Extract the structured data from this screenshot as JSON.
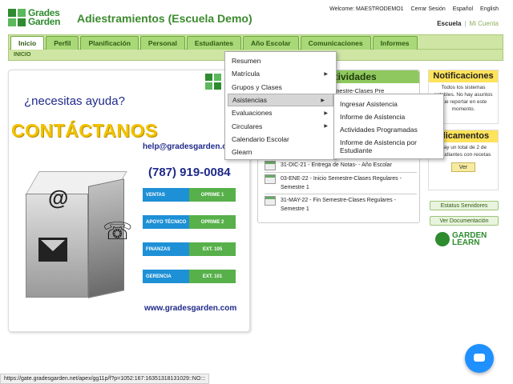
{
  "header": {
    "logo_line1": "Grades",
    "logo_line2": "Garden",
    "title": "Adiestramientos (Escuela Demo)",
    "welcome": "Welcome: MAESTRODEMO1",
    "logout": "Cerrar Sesión",
    "lang_es": "Español",
    "lang_en": "English",
    "school": "Escuela",
    "my_account": "Mi Cuenta"
  },
  "nav": {
    "tabs": [
      "Inicio",
      "Perfil",
      "Planificación",
      "Personal",
      "Estudiantes",
      "Año Escolar",
      "Comunicaciones",
      "Informes"
    ],
    "breadcrumb": "INICIO"
  },
  "contact": {
    "help": "¿necesitas ayuda?",
    "headline": "CONTÁCTANOS",
    "email": "help@gradesgarden.co",
    "phone": "(787) 919-0084",
    "rows": [
      {
        "label": "VENTAS",
        "value": "OPRIME 1"
      },
      {
        "label": "APOYO TÉCNICO",
        "value": "OPRIME 2"
      },
      {
        "label": "FINANZAS",
        "value": "EXT. 105"
      },
      {
        "label": "GERENCIA",
        "value": "EXT. 101"
      }
    ],
    "website": "www.gradesgarden.com"
  },
  "activities": {
    "header": "ctividades",
    "fragment": "Semestre-Clases Pre",
    "items": [
      "31-DIC-21 - Entrega de Notas- - Año Escolar",
      "03-ENE-22 - Inicio Semestre-Clases Regulares - Semestre 1",
      "31-MAY-22 - Fin Semestre-Clases Regulares - Semestre 1"
    ]
  },
  "notifications": {
    "title": "Notificaciones",
    "body": "Todos los sistemas estables. No hay asuntos que reportar en este momento."
  },
  "medications": {
    "title": "dicamentos",
    "body": "Hay un total de 2 de estudiantes con recetas",
    "button": "Ver"
  },
  "side_buttons": {
    "status": "Estatus Servidores",
    "docs": "Ver Documentación"
  },
  "garden_learn": {
    "line1": "GARDEN",
    "line2": "LEARN"
  },
  "menu_year": {
    "items": [
      {
        "label": "Resumen",
        "sub": false
      },
      {
        "label": "Matrícula",
        "sub": true
      },
      {
        "label": "Grupos y Clases",
        "sub": false
      },
      {
        "label": "Asistencias",
        "sub": true
      },
      {
        "label": "Evaluaciones",
        "sub": true
      },
      {
        "label": "Circulares",
        "sub": true
      },
      {
        "label": "Calendario Escolar",
        "sub": false
      },
      {
        "label": "Glearn",
        "sub": false
      }
    ]
  },
  "menu_attendance": {
    "items": [
      "Ingresar Asistencia",
      "Informe de Asistencia",
      "Actividades Programadas",
      "Informe de Asistencia por Estudiante"
    ]
  },
  "status_url": "https://gate.gradesgarden.net/apex/gg11p/f?p=1052:167:16351318131029::NO:::"
}
